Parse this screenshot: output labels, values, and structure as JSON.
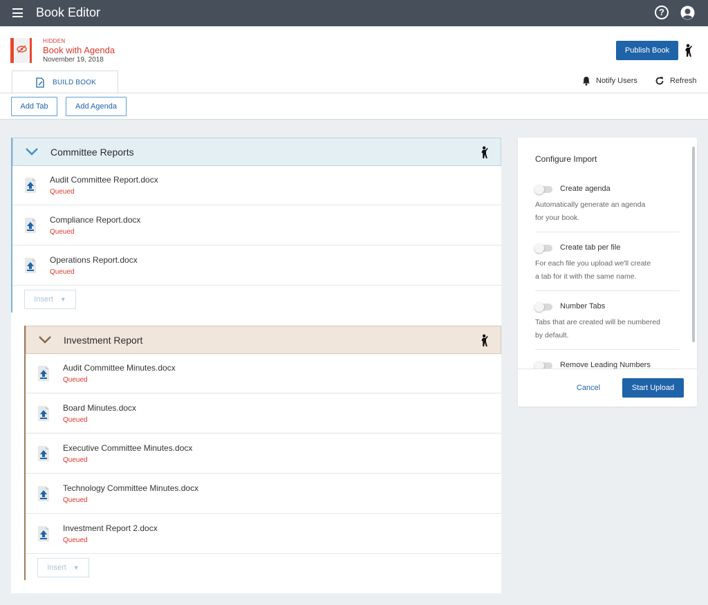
{
  "app": {
    "title": "Book Editor"
  },
  "book": {
    "visibility": "HIDDEN",
    "title": "Book with Agenda",
    "date": "November 19, 2018",
    "accent_color": "#d9372b"
  },
  "header": {
    "publish_label": "Publish Book"
  },
  "tabs": [
    {
      "label": "BUILD BOOK"
    }
  ],
  "actions": {
    "notify_label": "Notify Users",
    "refresh_label": "Refresh",
    "add_tab_label": "Add Tab",
    "add_agenda_label": "Add Agenda"
  },
  "sections": [
    {
      "title": "Committee Reports",
      "color": "#e4eff4",
      "files": [
        {
          "name": "Audit Committee Report.docx",
          "status": "Queued"
        },
        {
          "name": "Compliance Report.docx",
          "status": "Queued"
        },
        {
          "name": "Operations Report.docx",
          "status": "Queued"
        }
      ],
      "insert_label": "Insert"
    },
    {
      "title": "Investment Report",
      "color": "#f1e6dc",
      "files": [
        {
          "name": "Audit Committee Minutes.docx",
          "status": "Queued"
        },
        {
          "name": "Board Minutes.docx",
          "status": "Queued"
        },
        {
          "name": "Executive Committee Minutes.docx",
          "status": "Queued"
        },
        {
          "name": "Technology Committee Minutes.docx",
          "status": "Queued"
        },
        {
          "name": "Investment Report 2.docx",
          "status": "Queued"
        }
      ],
      "insert_label": "Insert"
    }
  ],
  "import_panel": {
    "title": "Configure Import",
    "options": [
      {
        "label": "Create agenda",
        "desc_line1": "Automatically generate an agenda",
        "desc_line2": "for your book.",
        "enabled": false
      },
      {
        "label": "Create tab per file",
        "desc_line1": "For each file you upload we'll create",
        "desc_line2": "a tab for it with the same name.",
        "enabled": false
      },
      {
        "label": "Number Tabs",
        "desc_line1": "Tabs that are created will be numbered",
        "desc_line2": "by default.",
        "enabled": false
      },
      {
        "label": "Remove Leading Numbers",
        "enabled": false
      }
    ],
    "cancel_label": "Cancel",
    "start_label": "Start Upload"
  },
  "colors": {
    "topbar": "#47505a",
    "primary": "#1f63a8",
    "queued": "#d9372b"
  }
}
